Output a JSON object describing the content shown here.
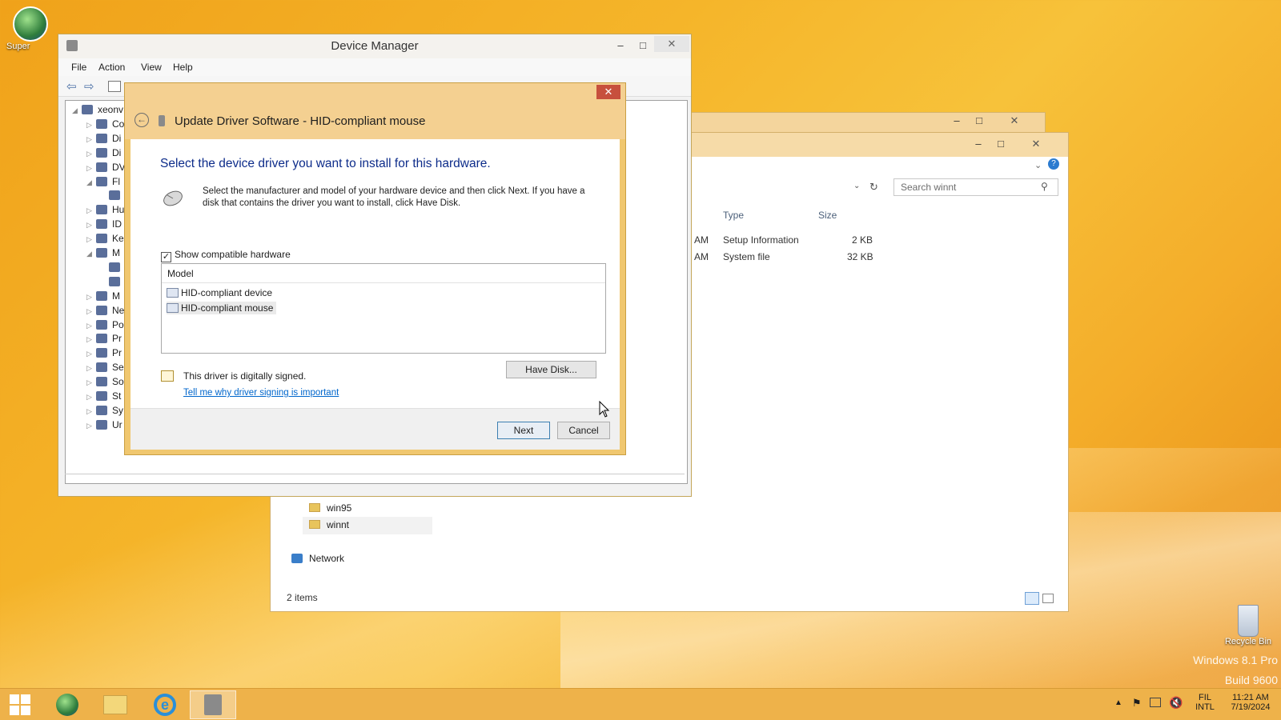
{
  "desktop": {
    "icon_super_label": "Super",
    "recycle_label": "Recycle Bin",
    "watermark_line1": "Windows 8.1 Pro",
    "watermark_line2": "Build 9600"
  },
  "explorer": {
    "search_placeholder": "Search winnt",
    "columns": {
      "type": "Type",
      "size": "Size"
    },
    "rows": [
      {
        "time_suffix": "AM",
        "type": "Setup Information",
        "size": "2 KB"
      },
      {
        "time_suffix": "AM",
        "type": "System file",
        "size": "32 KB"
      }
    ],
    "tree": [
      {
        "label": "win95"
      },
      {
        "label": "winnt"
      },
      {
        "label": "Network"
      }
    ],
    "status": "2 items"
  },
  "device_manager": {
    "title": "Device Manager",
    "menu": [
      "File",
      "Action",
      "View",
      "Help"
    ],
    "tree": [
      "xeonv",
      "Co",
      "Di",
      "Di",
      "DV",
      "Fl",
      "",
      "Hu",
      "ID",
      "Ke",
      "M",
      "",
      "",
      "M",
      "Ne",
      "Po",
      "Pr",
      "Pr",
      "Se",
      "So",
      "St",
      "Sy",
      "Ur"
    ]
  },
  "dialog": {
    "title": "Update Driver Software - HID-compliant mouse",
    "instruction": "Select the device driver you want to install for this hardware.",
    "description": "Select the manufacturer and model of your hardware device and then click Next. If you have a disk that contains the driver you want to install, click Have Disk.",
    "show_compatible_label": "Show compatible hardware",
    "show_compatible_checked": true,
    "model_header": "Model",
    "models": [
      "HID-compliant device",
      "HID-compliant mouse"
    ],
    "selected_model_index": 1,
    "signed_text": "This driver is digitally signed.",
    "signing_link": "Tell me why driver signing is important",
    "have_disk_label": "Have Disk...",
    "next_label": "Next",
    "cancel_label": "Cancel"
  },
  "taskbar": {
    "lang_line1": "FIL",
    "lang_line2": "INTL",
    "time": "11:21 AM",
    "date": "7/19/2024"
  },
  "colors": {
    "accent": "#f0c76f",
    "close_button": "#c7503d",
    "link": "#0066cc",
    "instruction_blue": "#0d2c8a"
  }
}
